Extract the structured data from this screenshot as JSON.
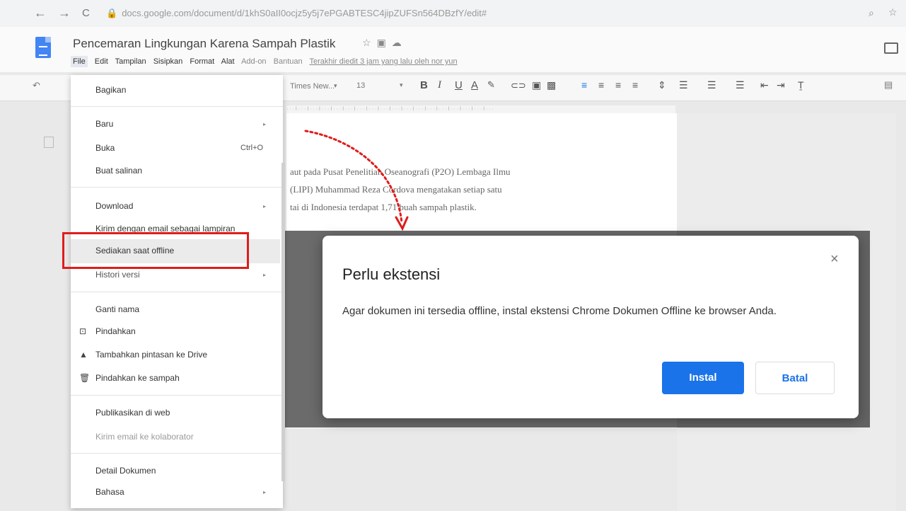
{
  "browser": {
    "url": "docs.google.com/document/d/1khS0aII0ocjz5y5j7ePGABTESC4jipZUFSn564DBzfY/edit#",
    "back_glyph": "←",
    "forward_glyph": "→",
    "reload_glyph": "C"
  },
  "doc": {
    "title": "Pencemaran Lingkungan Karena Sampah Plastik",
    "menu": [
      "File",
      "Edit",
      "Tampilan",
      "Sisipkan",
      "Format",
      "Alat",
      "Add-on",
      "Bantuan"
    ],
    "last_edit": "Terakhir diedit 3 jam yang lalu oleh nor yun",
    "toolbar": {
      "font": "Times New...",
      "font_size": "13",
      "bold": "B",
      "italic": "I",
      "underline": "U",
      "text_color": "A"
    },
    "body_lines": [
      "aut pada Pusat Penelitian Oseanografi (P2O) Lembaga Ilmu",
      "(LIPI) Muhammad Reza Cordova mengatakan setiap satu",
      "tai di Indonesia terdapat 1,71 buah sampah plastik."
    ]
  },
  "file_menu": {
    "items": {
      "bagikan": "Bagikan",
      "baru": "Baru",
      "buka": "Buka",
      "buka_shortcut": "Ctrl+O",
      "buat_salinan": "Buat salinan",
      "download": "Download",
      "kirim_email_lampiran": "Kirim dengan email sebagai lampiran",
      "sediakan_offline": "Sediakan saat offline",
      "histori_versi": "Histori versi",
      "ganti_nama": "Ganti nama",
      "pindahkan": "Pindahkan",
      "tambahkan_pintasan": "Tambahkan pintasan ke Drive",
      "pindahkan_sampah": "Pindahkan ke sampah",
      "publikasikan": "Publikasikan di web",
      "kirim_kolaborator": "Kirim email ke kolaborator",
      "detail_dokumen": "Detail Dokumen",
      "bahasa": "Bahasa"
    }
  },
  "dialog": {
    "title": "Perlu ekstensi",
    "message": "Agar dokumen ini tersedia offline, instal ekstensi Chrome Dokumen Offline ke browser Anda.",
    "primary_button": "Instal",
    "secondary_button": "Batal",
    "close_glyph": "×"
  },
  "colors": {
    "primary": "#1a73e8",
    "highlight_box": "#e01c1c",
    "docs_blue": "#4285f4"
  }
}
